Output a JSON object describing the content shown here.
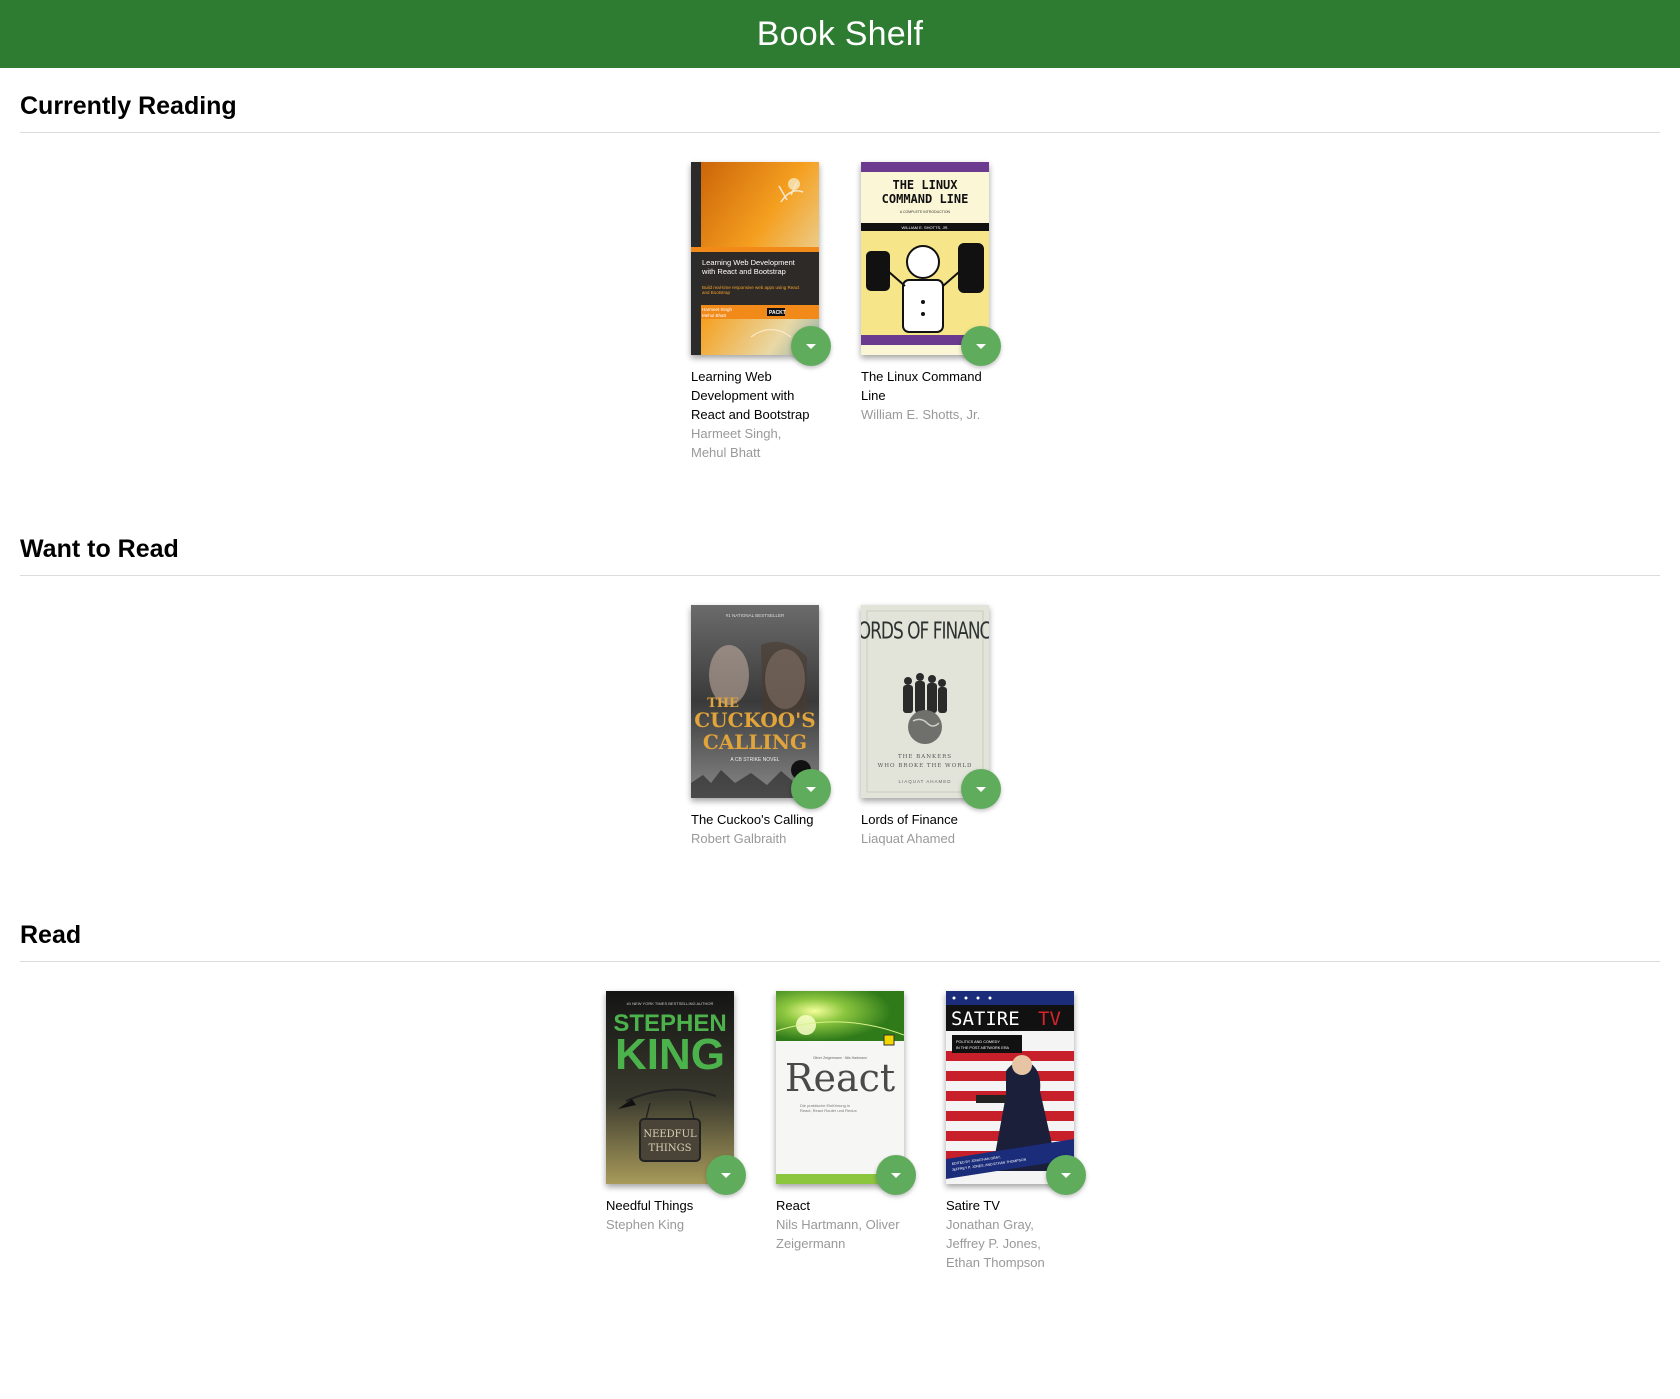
{
  "app": {
    "title": "Book Shelf"
  },
  "colors": {
    "header": "#2e7c31",
    "changer_button": "#60ac5d",
    "author_text": "#999999"
  },
  "shelves": [
    {
      "title": "Currently Reading",
      "books": [
        {
          "title": "Learning Web Development with React and Bootstrap",
          "authors": "Harmeet Singh, Mehul Bhatt",
          "cover_text": "Learning Web Development with React and Bootstrap",
          "cover_sub": "Build real-time responsive web apps using React and Bootstrap",
          "cover_authors": "Harmeet Singh\nMehul Bhatt",
          "publisher": "PACKT",
          "changer_icon": "arrow-drop-down-icon"
        },
        {
          "title": "The Linux Command Line",
          "authors": "William E. Shotts, Jr.",
          "cover_text_1": "THE LINUX",
          "cover_text_2": "COMMAND LINE",
          "cover_sub": "A COMPLETE INTRODUCTION",
          "cover_author": "WILLIAM E. SHOTTS, JR.",
          "changer_icon": "arrow-drop-down-icon"
        }
      ]
    },
    {
      "title": "Want to Read",
      "books": [
        {
          "title": "The Cuckoo's Calling",
          "authors": "Robert Galbraith",
          "cover_top": "#1 NATIONAL BESTSELLER",
          "cover_text_1": "THE",
          "cover_text_2": "CUCKOO'S",
          "cover_text_3": "CALLING",
          "cover_sub": "A CB STRIKE NOVEL",
          "changer_icon": "arrow-drop-down-icon"
        },
        {
          "title": "Lords of Finance",
          "authors": "Liaquat Ahamed",
          "cover_text": "LORDS OF FINANCE",
          "cover_sub_1": "THE BANKERS",
          "cover_sub_2": "WHO BROKE THE WORLD",
          "cover_author": "LIAQUAT AHAMED",
          "changer_icon": "arrow-drop-down-icon"
        }
      ]
    },
    {
      "title": "Read",
      "books": [
        {
          "title": "Needful Things",
          "authors": "Stephen King",
          "cover_top": "#1 NEW YORK TIMES BESTSELLING AUTHOR",
          "cover_text_1": "STEPHEN",
          "cover_text_2": "KING",
          "cover_sign_1": "NEEDFUL",
          "cover_sign_2": "THINGS",
          "changer_icon": "arrow-drop-down-icon"
        },
        {
          "title": "React",
          "authors": "Nils Hartmann, Oliver Zeigermann",
          "cover_authors": "Oliver Zeigermann · Nils Hartmann",
          "cover_text": "React",
          "cover_sub_1": "Die praktische Einführung in",
          "cover_sub_2": "React, React Router und Redux",
          "changer_icon": "arrow-drop-down-icon"
        },
        {
          "title": "Satire TV",
          "authors": "Jonathan Gray, Jeffrey P. Jones, Ethan Thompson",
          "cover_text_1": "SATIRE",
          "cover_text_2": "TV",
          "cover_sub_1": "POLITICS AND COMEDY",
          "cover_sub_2": "IN THE POST-NETWORK ERA",
          "cover_author_1": "EDITED BY JONATHAN GRAY,",
          "cover_author_2": "JEFFREY P. JONES, AND ETHAN THOMPSON",
          "changer_icon": "arrow-drop-down-icon"
        }
      ]
    }
  ]
}
